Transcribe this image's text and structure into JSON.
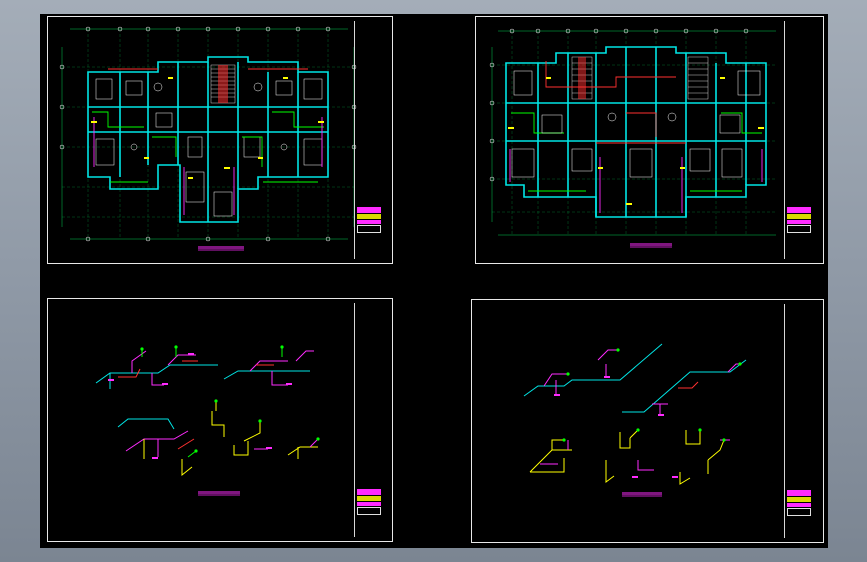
{
  "sheets": [
    {
      "id": "floor-plan-a",
      "caption": "",
      "title_block_labels": [
        "",
        "",
        "",
        ""
      ]
    },
    {
      "id": "floor-plan-b",
      "caption": "",
      "title_block_labels": [
        "",
        "",
        "",
        ""
      ]
    },
    {
      "id": "pipe-isometric-a",
      "caption": "",
      "title_block_labels": [
        "",
        "",
        "",
        ""
      ]
    },
    {
      "id": "pipe-isometric-b",
      "caption": "",
      "title_block_labels": [
        "",
        "",
        "",
        ""
      ]
    }
  ],
  "colors": {
    "background_gradient_top": "#a4adb8",
    "viewport_background": "#000000",
    "wall": "#00e5e5",
    "axis_grid": "#00ff66",
    "water_pipe": "#00ff00",
    "drain_pipe": "#ff2bff",
    "hot_pipe": "#ff3030",
    "annotation": "#ffff00",
    "fixtures": "#ffffff"
  }
}
